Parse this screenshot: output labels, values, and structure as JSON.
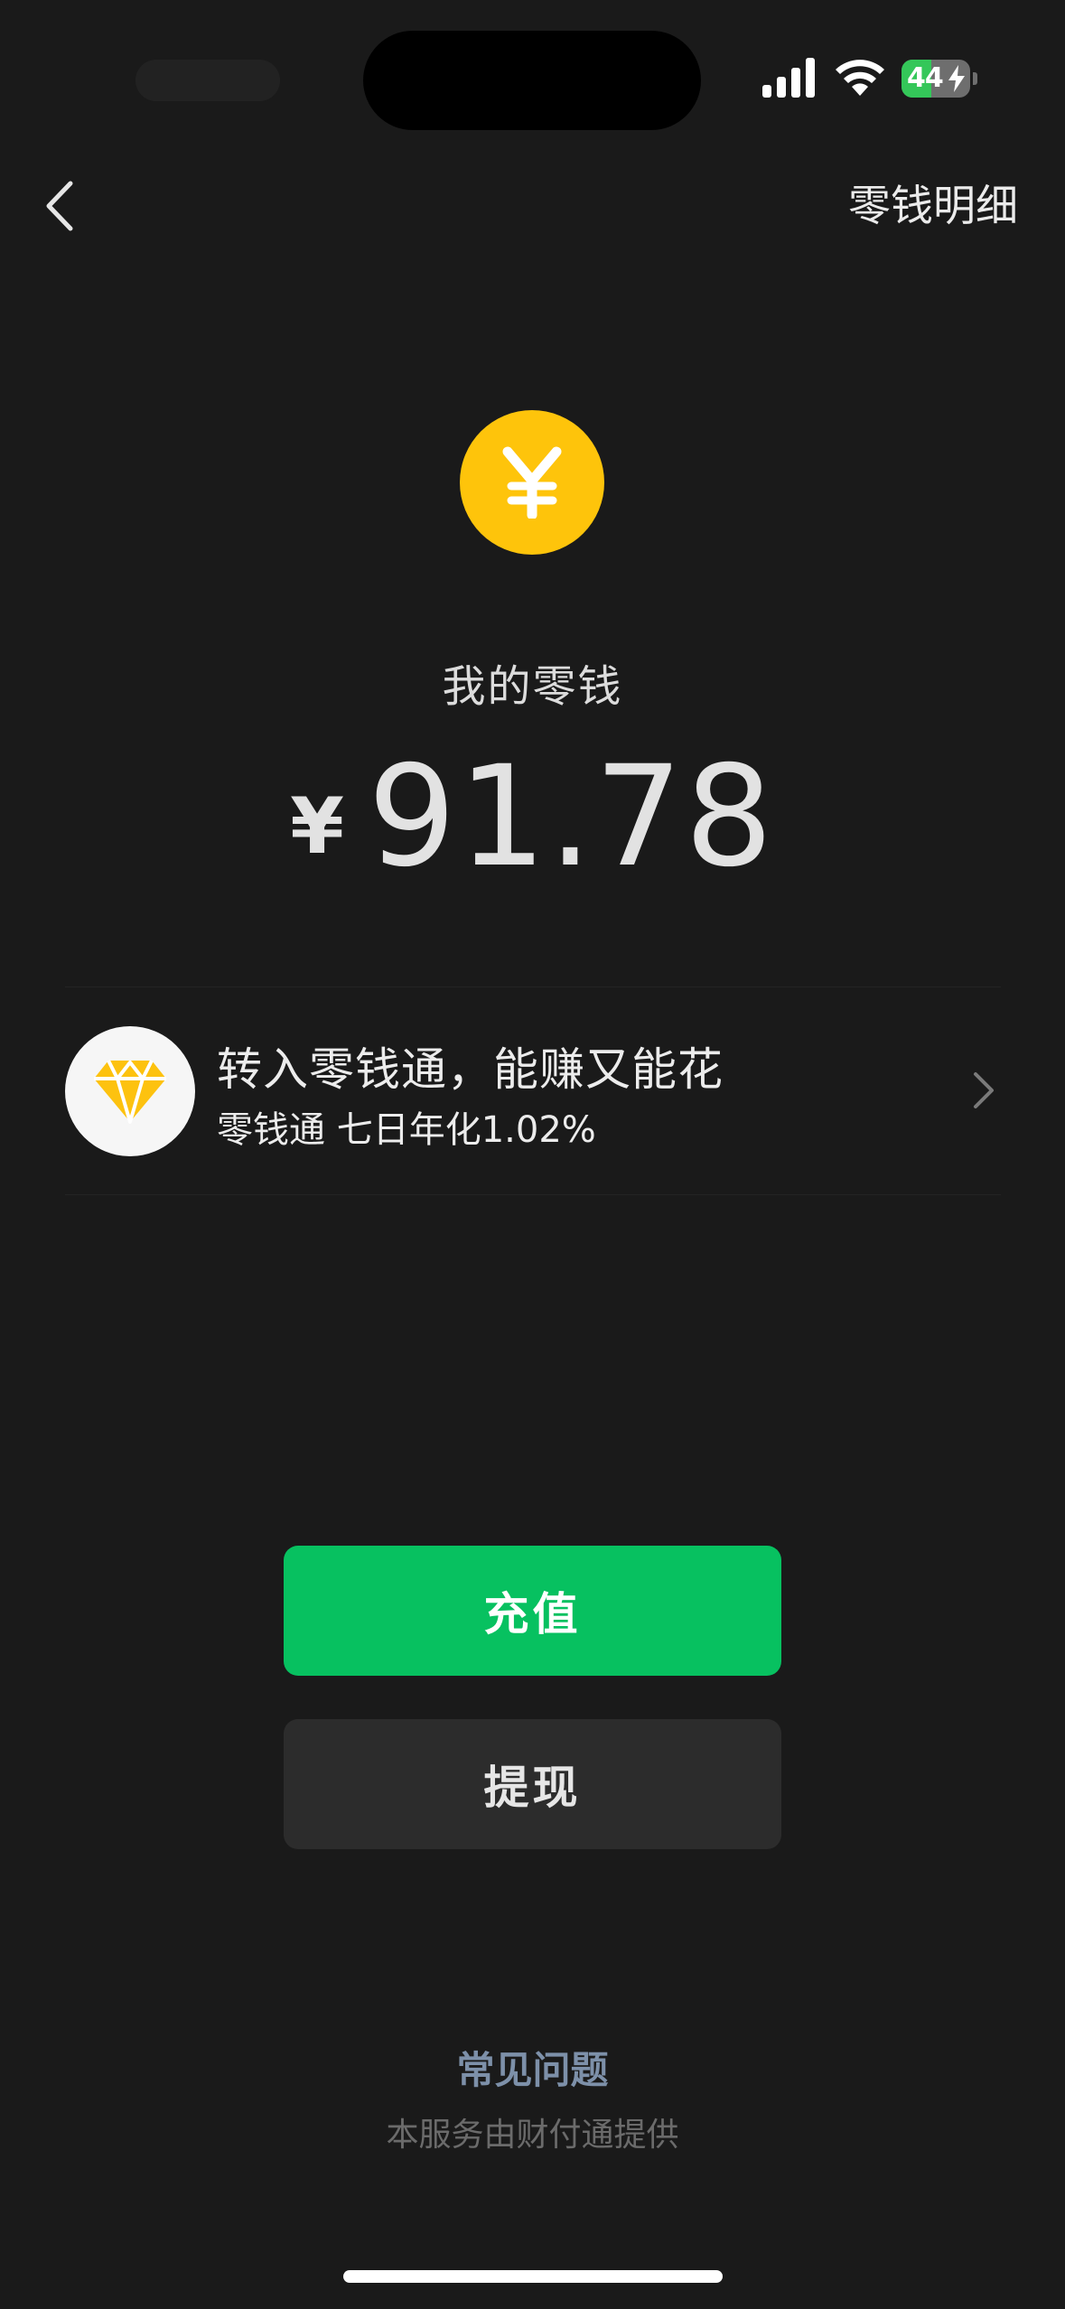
{
  "status_bar": {
    "battery_level": 44,
    "battery_label": "44",
    "charging": true
  },
  "nav": {
    "back_icon": "chevron-left-icon",
    "detail_link": "零钱明细"
  },
  "balance": {
    "icon": "yuan-coin-icon",
    "coin_symbol": "¥",
    "title": "我的零钱",
    "currency": "¥",
    "amount": "91.78"
  },
  "promo": {
    "icon": "diamond-icon",
    "title": "转入零钱通，能赚又能花",
    "subtitle": "零钱通 七日年化1.02%",
    "chevron_icon": "chevron-right-icon"
  },
  "actions": {
    "recharge_label": "充值",
    "withdraw_label": "提现"
  },
  "footer": {
    "faq_label": "常见问题",
    "provider_note": "本服务由财付通提供"
  },
  "colors": {
    "background": "#1a1a1a",
    "accent_green": "#07c160",
    "coin_yellow": "#fec40b",
    "link_blue": "#7d90a9",
    "secondary_button": "#2c2c2c"
  }
}
